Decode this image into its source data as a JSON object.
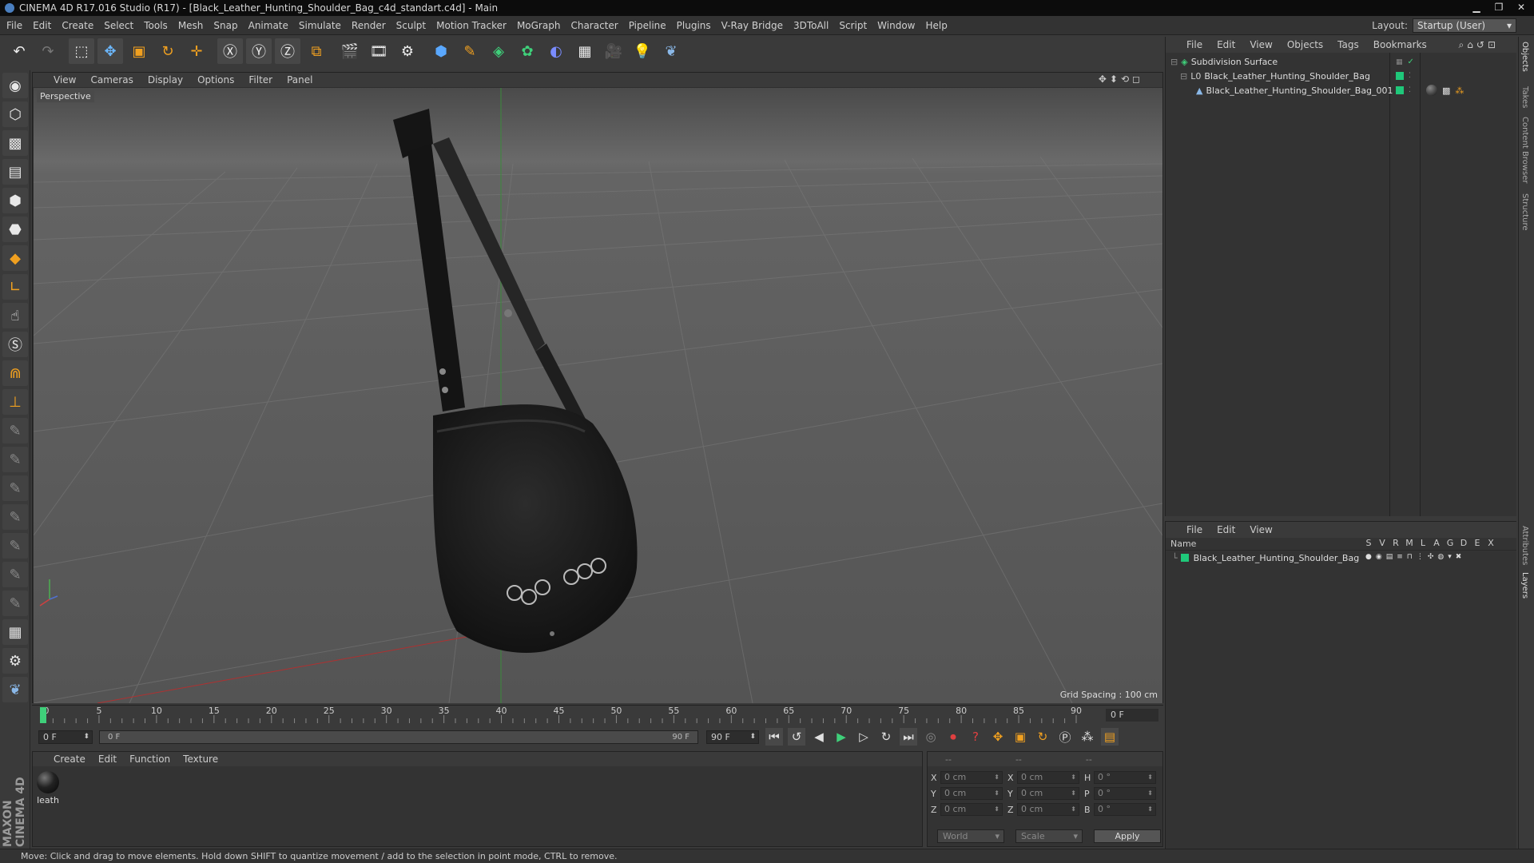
{
  "window": {
    "title": "CINEMA 4D R17.016 Studio (R17) - [Black_Leather_Hunting_Shoulder_Bag_c4d_standart.c4d] - Main"
  },
  "menu": [
    "File",
    "Edit",
    "Create",
    "Select",
    "Tools",
    "Mesh",
    "Snap",
    "Animate",
    "Simulate",
    "Render",
    "Sculpt",
    "Motion Tracker",
    "MoGraph",
    "Character",
    "Pipeline",
    "Plugins",
    "V-Ray Bridge",
    "3DToAll",
    "Script",
    "Window",
    "Help"
  ],
  "layout": {
    "label": "Layout:",
    "value": "Startup (User)"
  },
  "viewport": {
    "menu": [
      "View",
      "Cameras",
      "Display",
      "Options",
      "Filter",
      "Panel"
    ],
    "label": "Perspective",
    "grid_spacing": "Grid Spacing : 100 cm"
  },
  "timeline": {
    "ticks": [
      "0",
      "5",
      "10",
      "15",
      "20",
      "25",
      "30",
      "35",
      "40",
      "45",
      "50",
      "55",
      "60",
      "65",
      "70",
      "75",
      "80",
      "85",
      "90"
    ],
    "current_frame": "0 F"
  },
  "transport": {
    "start": "0 F",
    "range_start": "0 F",
    "range_end": "90 F",
    "end": "90 F"
  },
  "materials": {
    "menu": [
      "Create",
      "Edit",
      "Function",
      "Texture"
    ],
    "items": [
      {
        "label": "leath"
      }
    ]
  },
  "coords": {
    "head": [
      "--",
      "--",
      "--"
    ],
    "rows": [
      {
        "a": "X",
        "av": "0 cm",
        "b": "X",
        "bv": "0 cm",
        "c": "H",
        "cv": "0 °"
      },
      {
        "a": "Y",
        "av": "0 cm",
        "b": "Y",
        "bv": "0 cm",
        "c": "P",
        "cv": "0 °"
      },
      {
        "a": "Z",
        "av": "0 cm",
        "b": "Z",
        "bv": "0 cm",
        "c": "B",
        "cv": "0 °"
      }
    ],
    "space": "World",
    "mode": "Scale",
    "apply": "Apply"
  },
  "objects": {
    "menu": [
      "File",
      "Edit",
      "View",
      "Objects",
      "Tags",
      "Bookmarks"
    ],
    "tree": [
      {
        "name": "Subdivision Surface"
      },
      {
        "name": "Black_Leather_Hunting_Shoulder_Bag"
      },
      {
        "name": "Black_Leather_Hunting_Shoulder_Bag_001"
      }
    ]
  },
  "layers": {
    "menu": [
      "File",
      "Edit",
      "View"
    ],
    "header": "Name",
    "cols": [
      "S",
      "V",
      "R",
      "M",
      "L",
      "A",
      "G",
      "D",
      "E",
      "X"
    ],
    "rows": [
      {
        "name": "Black_Leather_Hunting_Shoulder_Bag"
      }
    ]
  },
  "sidetabs": [
    "Objects",
    "Takes",
    "Content Browser",
    "Structure",
    "Attributes",
    "Layers"
  ],
  "maxon": "MAXON CINEMA 4D",
  "status": "Move: Click and drag to move elements. Hold down SHIFT to quantize movement / add to the selection in point mode, CTRL to remove.",
  "colors": {
    "accent": "#1fc87a",
    "grid_green": "#3a8a3a",
    "axis_red": "#b03030"
  }
}
